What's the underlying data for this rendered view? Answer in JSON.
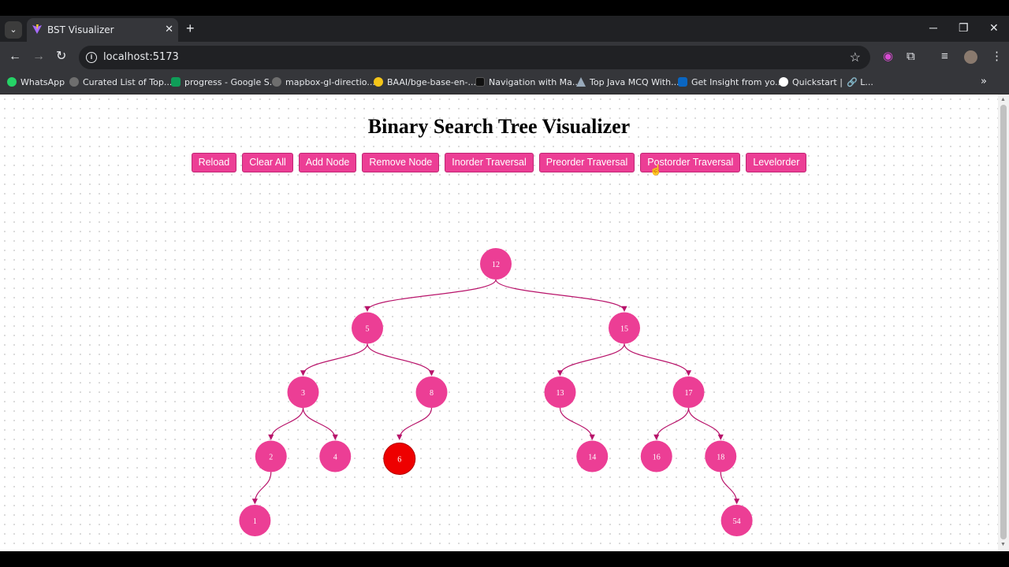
{
  "browser": {
    "tab_title": "BST Visualizer",
    "tab_list_icon": "chevron-down-icon",
    "new_tab_icon": "+",
    "close_icon": "✕",
    "url": "localhost:5173",
    "bookmarks": [
      {
        "label": "WhatsApp",
        "color": "#25d366"
      },
      {
        "label": "Curated List of Top...",
        "color": "#6e6e6e"
      },
      {
        "label": "progress - Google S...",
        "color": "#0f9d58"
      },
      {
        "label": "mapbox-gl-directio...",
        "color": "#6e6e6e"
      },
      {
        "label": "BAAI/bge-base-en-...",
        "color": "#f5c518"
      },
      {
        "label": "Navigation with Ma...",
        "color": "#111111"
      },
      {
        "label": "Top Java MCQ With...",
        "color": "#9ab"
      },
      {
        "label": "Get Insight from yo...",
        "color": "#0a66c2"
      },
      {
        "label": "Quickstart |",
        "color": "#ffffff"
      },
      {
        "label": "L...",
        "color": "#e8eaed"
      }
    ]
  },
  "app": {
    "title": "Binary Search Tree Visualizer",
    "buttons": {
      "reload": "Reload",
      "clear_all": "Clear All",
      "add_node": "Add Node",
      "remove_node": "Remove Node",
      "inorder": "Inorder Traversal",
      "preorder": "Preorder Traversal",
      "postorder": "Postorder Traversal",
      "levelorder": "Levelorder"
    },
    "colors": {
      "node": "#ec3e95",
      "highlight": "#ee0000",
      "edge": "#b8136a"
    },
    "tree": {
      "value": "12",
      "left": {
        "value": "5",
        "left": {
          "value": "3",
          "left": {
            "value": "2",
            "left": {
              "value": "1"
            }
          },
          "right": {
            "value": "4"
          }
        },
        "right": {
          "value": "8",
          "left": {
            "value": "6",
            "highlighted": true
          }
        }
      },
      "right": {
        "value": "15",
        "left": {
          "value": "13",
          "right": {
            "value": "14"
          }
        },
        "right": {
          "value": "17",
          "left": {
            "value": "16"
          },
          "right": {
            "value": "18",
            "right": {
              "value": "54"
            }
          }
        }
      }
    }
  }
}
